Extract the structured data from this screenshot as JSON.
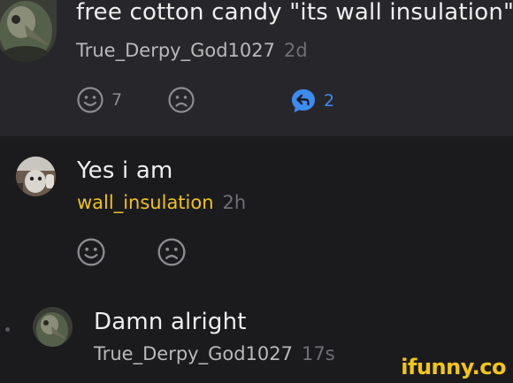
{
  "comments": [
    {
      "text": "free cotton candy \"its wall insulation\"",
      "username": "True_Derpy_God1027",
      "time": "2d",
      "like_count": "7",
      "reply_count": "2"
    },
    {
      "text": "Yes i am",
      "username": "wall_insulation",
      "time": "2h"
    },
    {
      "text": "Damn alright",
      "username": "True_Derpy_God1027",
      "time": "17s"
    }
  ],
  "watermark": "ifunny.co",
  "colors": {
    "top_panel": "#27272b",
    "bottom_panel": "#1b1b1e",
    "op_username": "#f1c21b",
    "reply_blue": "#3d8bef",
    "watermark": "#f3c614"
  },
  "icons": [
    "smile-icon",
    "frown-icon",
    "reply-icon",
    "avatar-plague-doctor",
    "avatar-meme"
  ]
}
